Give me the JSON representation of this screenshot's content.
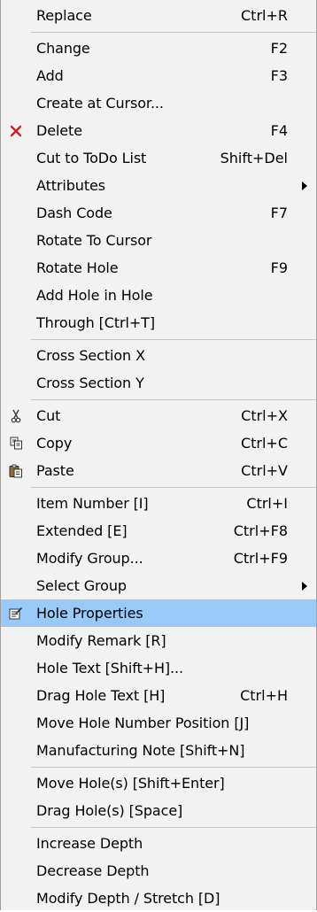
{
  "menu": {
    "replace": {
      "label": "Replace",
      "shortcut": "Ctrl+R"
    },
    "change": {
      "label": "Change",
      "shortcut": "F2"
    },
    "add": {
      "label": "Add",
      "shortcut": "F3"
    },
    "create_at_cursor": {
      "label": "Create at Cursor..."
    },
    "delete": {
      "label": "Delete",
      "shortcut": "F4",
      "icon": "red-x-icon"
    },
    "cut_todo": {
      "label": "Cut to ToDo List",
      "shortcut": "Shift+Del"
    },
    "attributes": {
      "label": "Attributes"
    },
    "dash_code": {
      "label": "Dash Code",
      "shortcut": "F7"
    },
    "rotate_to_cursor": {
      "label": "Rotate To Cursor"
    },
    "rotate_hole": {
      "label": "Rotate Hole",
      "shortcut": "F9"
    },
    "add_hole_in_hole": {
      "label": "Add Hole in Hole"
    },
    "through": {
      "label": "Through  [Ctrl+T]"
    },
    "cross_section_x": {
      "label": "Cross Section X"
    },
    "cross_section_y": {
      "label": "Cross Section Y"
    },
    "cut": {
      "label": "Cut",
      "shortcut": "Ctrl+X",
      "icon": "scissors-icon"
    },
    "copy": {
      "label": "Copy",
      "shortcut": "Ctrl+C",
      "icon": "copy-icon"
    },
    "paste": {
      "label": "Paste",
      "shortcut": "Ctrl+V",
      "icon": "clipboard-icon"
    },
    "item_number": {
      "label": "Item Number  [I]",
      "shortcut": "Ctrl+I"
    },
    "extended": {
      "label": "Extended  [E]",
      "shortcut": "Ctrl+F8"
    },
    "modify_group": {
      "label": "Modify Group...",
      "shortcut": "Ctrl+F9"
    },
    "select_group": {
      "label": "Select Group"
    },
    "hole_properties": {
      "label": "Hole Properties",
      "icon": "properties-icon"
    },
    "modify_remark": {
      "label": "Modify Remark  [R]"
    },
    "hole_text": {
      "label": "Hole Text  [Shift+H]..."
    },
    "drag_hole_text": {
      "label": "Drag Hole Text  [H]",
      "shortcut": "Ctrl+H"
    },
    "move_hole_number": {
      "label": "Move Hole Number Position  [J]"
    },
    "manufacturing_note": {
      "label": "Manufacturing Note  [Shift+N]"
    },
    "move_holes": {
      "label": "Move Hole(s)  [Shift+Enter]"
    },
    "drag_holes": {
      "label": "Drag Hole(s)  [Space]"
    },
    "increase_depth": {
      "label": "Increase Depth"
    },
    "decrease_depth": {
      "label": "Decrease Depth"
    },
    "modify_depth": {
      "label": "Modify Depth / Stretch [D]"
    }
  },
  "colors": {
    "menu_bg": "#f2f2f2",
    "highlight": "#99c9f6",
    "separator": "#c8c8c8",
    "delete_icon": "#d42020"
  }
}
